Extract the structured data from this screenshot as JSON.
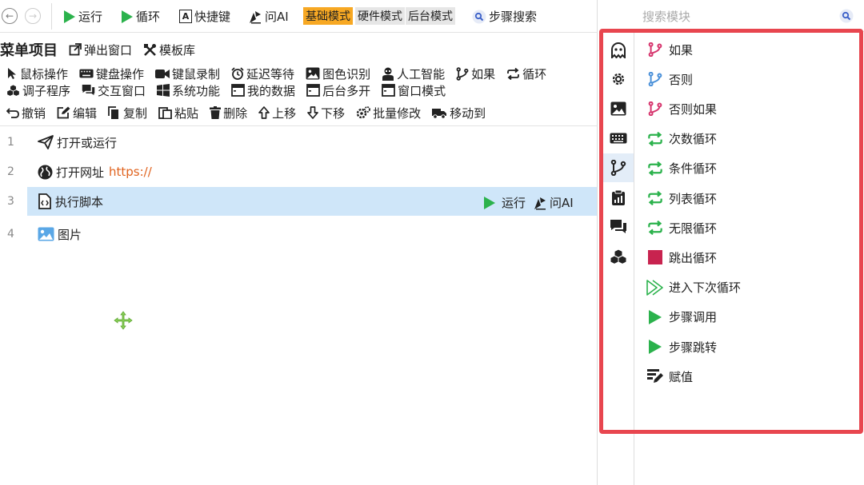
{
  "toolbar": {
    "back_icon": "arrow-left-icon",
    "forward_icon": "arrow-right-icon",
    "run_label": "运行",
    "loop_label": "循环",
    "shortcut_label": "快捷键",
    "ask_ai_label": "问AI",
    "modes": [
      "基础模式",
      "硬件模式",
      "后台模式"
    ],
    "active_mode": "基础模式",
    "step_search_label": "步骤搜索"
  },
  "menu": {
    "title": "菜单项目",
    "popup_label": "弹出窗口",
    "template_label": "模板库"
  },
  "categories_row1": [
    {
      "label": "鼠标操作",
      "icon": "mouse-pointer-icon"
    },
    {
      "label": "键盘操作",
      "icon": "keyboard-icon"
    },
    {
      "label": "键鼠录制",
      "icon": "video-camera-icon"
    },
    {
      "label": "延迟等待",
      "icon": "alarm-clock-icon"
    },
    {
      "label": "图色识别",
      "icon": "image-icon"
    },
    {
      "label": "人工智能",
      "icon": "robot-icon"
    },
    {
      "label": "如果",
      "icon": "branch-icon"
    },
    {
      "label": "循环",
      "icon": "loop-icon"
    }
  ],
  "categories_row2": [
    {
      "label": "调子程序",
      "icon": "cubes-icon"
    },
    {
      "label": "交互窗口",
      "icon": "chat-icon"
    },
    {
      "label": "系统功能",
      "icon": "windows-icon"
    },
    {
      "label": "我的数据",
      "icon": "window-icon"
    },
    {
      "label": "后台多开",
      "icon": "window-icon"
    },
    {
      "label": "窗口模式",
      "icon": "window-icon"
    }
  ],
  "edit_row": [
    {
      "label": "撤销",
      "icon": "undo-icon"
    },
    {
      "label": "编辑",
      "icon": "edit-icon"
    },
    {
      "label": "复制",
      "icon": "copy-icon"
    },
    {
      "label": "粘贴",
      "icon": "paste-icon"
    },
    {
      "label": "删除",
      "icon": "trash-icon"
    },
    {
      "label": "上移",
      "icon": "arrow-up-icon"
    },
    {
      "label": "下移",
      "icon": "arrow-down-icon"
    },
    {
      "label": "批量修改",
      "icon": "gears-icon"
    },
    {
      "label": "移动到",
      "icon": "truck-icon"
    }
  ],
  "steps": [
    {
      "num": "1",
      "label": "打开或运行",
      "icon": "paper-plane-icon",
      "extra": ""
    },
    {
      "num": "2",
      "label": "打开网址",
      "icon": "globe-icon",
      "extra": "https://"
    },
    {
      "num": "3",
      "label": "执行脚本",
      "icon": "script-file-icon",
      "extra": "",
      "run_label": "运行",
      "ask_ai_label": "问AI"
    },
    {
      "num": "4",
      "label": "图片",
      "icon": "picture-icon",
      "extra": ""
    }
  ],
  "search": {
    "placeholder": "搜索模块"
  },
  "category_icons": [
    "ghost-icon",
    "gear-icon",
    "image-icon",
    "keyboard-icon",
    "branch-icon",
    "clipboard-chart-icon",
    "chat-icon",
    "cubes-icon"
  ],
  "modules": [
    {
      "label": "如果",
      "icon": "branch-icon"
    },
    {
      "label": "否则",
      "icon": "branch-icon"
    },
    {
      "label": "否则如果",
      "icon": "branch-icon"
    },
    {
      "label": "次数循环",
      "icon": "loop-icon"
    },
    {
      "label": "条件循环",
      "icon": "loop-icon"
    },
    {
      "label": "列表循环",
      "icon": "loop-icon"
    },
    {
      "label": "无限循环",
      "icon": "loop-icon"
    },
    {
      "label": "跳出循环",
      "icon": "stop-square-icon"
    },
    {
      "label": "进入下次循环",
      "icon": "next-outline-icon"
    },
    {
      "label": "步骤调用",
      "icon": "play-icon"
    },
    {
      "label": "步骤跳转",
      "icon": "play-icon"
    },
    {
      "label": "赋值",
      "icon": "assign-icon"
    }
  ],
  "colors": {
    "green": "#2bb24c",
    "pink": "#d6336c",
    "blue": "#4a90d9",
    "mode_active": "#f7a823",
    "selected_row": "#cfe6f9",
    "highlight_box": "#e8464f",
    "url": "#e0621d"
  }
}
